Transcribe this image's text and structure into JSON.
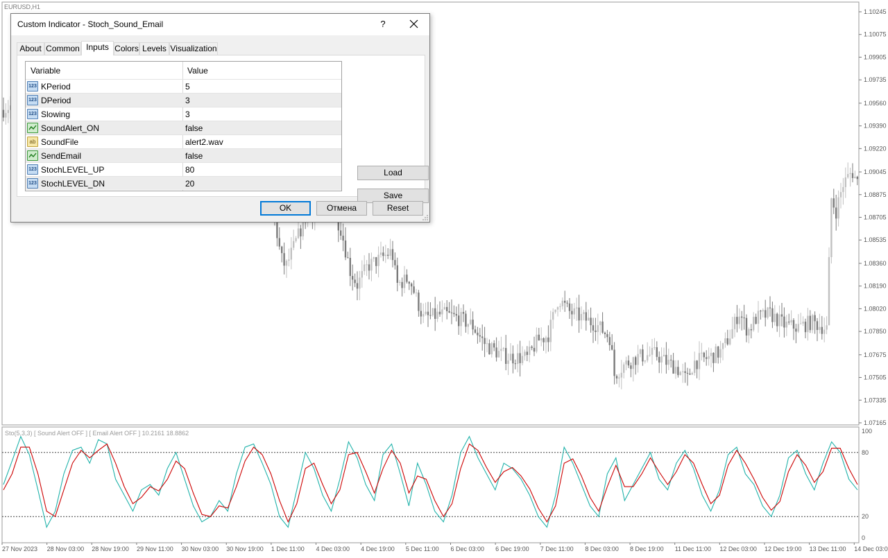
{
  "chart": {
    "symbol_label": "EURUSD,H1",
    "price_ticks": [
      "1.10245",
      "1.10075",
      "1.09905",
      "1.09735",
      "1.09560",
      "1.09390",
      "1.09220",
      "1.09045",
      "1.08875",
      "1.08705",
      "1.08535",
      "1.08360",
      "1.08190",
      "1.08020",
      "1.07850",
      "1.07675",
      "1.07505",
      "1.07335",
      "1.07165"
    ],
    "time_ticks": [
      "27 Nov 2023",
      "28 Nov 03:00",
      "28 Nov 19:00",
      "29 Nov 11:00",
      "30 Nov 03:00",
      "30 Nov 19:00",
      "1 Dec 11:00",
      "4 Dec 03:00",
      "4 Dec 19:00",
      "5 Dec 11:00",
      "6 Dec 03:00",
      "6 Dec 19:00",
      "7 Dec 11:00",
      "8 Dec 03:00",
      "8 Dec 19:00",
      "11 Dec 11:00",
      "12 Dec 03:00",
      "12 Dec 19:00",
      "13 Dec 11:00",
      "14 Dec 03:00"
    ],
    "indicator_label": "Sto(5,3,3) [ Sound Alert OFF ] [ Email Alert OFF ] 10.2161 18.8862",
    "stoch_ticks": [
      "100",
      "80",
      "20",
      "0"
    ],
    "colors": {
      "main_line": "#20b2aa",
      "signal_line": "#cc0000",
      "candle_up": "#c0c0c0",
      "candle_down": "#7a7a7a",
      "level_line": "#404040"
    }
  },
  "chart_data": [
    {
      "type": "candlestick",
      "title": "EURUSD,H1",
      "ylim": [
        1.07165,
        1.10245
      ],
      "close_path": [
        [
          0,
          1.095
        ],
        [
          20,
          1.0955
        ],
        [
          60,
          1.0942
        ],
        [
          120,
          1.0935
        ],
        [
          200,
          1.0915
        ],
        [
          280,
          1.0905
        ],
        [
          340,
          1.0895
        ],
        [
          390,
          1.0888
        ],
        [
          405,
          1.084
        ],
        [
          412,
          1.0833
        ],
        [
          440,
          1.087
        ],
        [
          470,
          1.088
        ],
        [
          490,
          1.0865
        ],
        [
          505,
          1.083
        ],
        [
          515,
          1.082
        ],
        [
          530,
          1.0834
        ],
        [
          550,
          1.084
        ],
        [
          565,
          1.0845
        ],
        [
          572,
          1.082
        ],
        [
          590,
          1.0825
        ],
        [
          600,
          1.081
        ],
        [
          610,
          1.0795
        ],
        [
          640,
          1.0798
        ],
        [
          660,
          1.0795
        ],
        [
          680,
          1.079
        ],
        [
          700,
          1.0775
        ],
        [
          715,
          1.077
        ],
        [
          730,
          1.0766
        ],
        [
          760,
          1.0765
        ],
        [
          775,
          1.0778
        ],
        [
          790,
          1.0782
        ],
        [
          805,
          1.081
        ],
        [
          820,
          1.08
        ],
        [
          840,
          1.0795
        ],
        [
          860,
          1.079
        ],
        [
          880,
          1.078
        ],
        [
          885,
          1.0752
        ],
        [
          900,
          1.076
        ],
        [
          920,
          1.0766
        ],
        [
          945,
          1.0768
        ],
        [
          960,
          1.0762
        ],
        [
          975,
          1.0758
        ],
        [
          990,
          1.0748
        ],
        [
          1000,
          1.0762
        ],
        [
          1020,
          1.0765
        ],
        [
          1040,
          1.077
        ],
        [
          1055,
          1.0785
        ],
        [
          1065,
          1.08
        ],
        [
          1078,
          1.0785
        ],
        [
          1090,
          1.0795
        ],
        [
          1110,
          1.0798
        ],
        [
          1130,
          1.079
        ],
        [
          1150,
          1.0788
        ],
        [
          1170,
          1.0792
        ],
        [
          1192,
          1.0787
        ],
        [
          1198,
          1.0885
        ],
        [
          1205,
          1.0875
        ],
        [
          1215,
          1.0895
        ],
        [
          1228,
          1.0905
        ],
        [
          1238,
          1.0895
        ]
      ]
    },
    {
      "type": "line",
      "title": "Sto(5,3,3) [ Sound Alert OFF ] [ Email Alert OFF ] 10.2161 18.8862",
      "ylim": [
        0,
        100
      ],
      "levels": [
        80,
        20
      ],
      "series": [
        {
          "values": [
            50,
            72,
            95,
            78,
            45,
            10,
            25,
            60,
            82,
            85,
            70,
            92,
            88,
            55,
            40,
            25,
            45,
            50,
            40,
            65,
            80,
            55,
            30,
            15,
            20,
            35,
            25,
            60,
            85,
            88,
            70,
            50,
            20,
            10,
            45,
            80,
            65,
            40,
            25,
            55,
            90,
            75,
            50,
            35,
            78,
            88,
            60,
            30,
            70,
            50,
            25,
            15,
            40,
            80,
            95,
            75,
            60,
            45,
            70,
            65,
            55,
            40,
            20,
            10,
            40,
            85,
            70,
            50,
            30,
            20,
            60,
            75,
            35,
            50,
            65,
            80,
            55,
            45,
            70,
            82,
            65,
            40,
            25,
            45,
            78,
            85,
            60,
            50,
            30,
            20,
            40,
            75,
            82,
            60,
            45,
            70,
            90,
            80,
            55,
            45
          ]
        },
        {
          "values": [
            45,
            60,
            85,
            85,
            60,
            25,
            20,
            45,
            70,
            82,
            75,
            82,
            88,
            70,
            48,
            32,
            38,
            48,
            44,
            55,
            72,
            65,
            42,
            22,
            20,
            30,
            28,
            48,
            72,
            85,
            78,
            60,
            35,
            15,
            32,
            65,
            70,
            50,
            32,
            45,
            78,
            80,
            62,
            42,
            65,
            82,
            70,
            42,
            58,
            55,
            35,
            20,
            32,
            65,
            88,
            82,
            66,
            52,
            62,
            66,
            58,
            46,
            28,
            15,
            30,
            70,
            74,
            58,
            38,
            25,
            48,
            68,
            48,
            48,
            60,
            75,
            62,
            50,
            62,
            78,
            70,
            50,
            32,
            40,
            68,
            82,
            70,
            55,
            38,
            26,
            34,
            62,
            78,
            68,
            52,
            62,
            84,
            84,
            65,
            50
          ]
        }
      ]
    }
  ],
  "dialog": {
    "title": "Custom Indicator - Stoch_Sound_Email",
    "help": "?",
    "tabs": [
      "About",
      "Common",
      "Inputs",
      "Colors",
      "Levels",
      "Visualization"
    ],
    "active_tab": "Inputs",
    "grid": {
      "col_variable": "Variable",
      "col_value": "Value",
      "rows": [
        {
          "icon": "number-icon",
          "icon_text": "123",
          "name": "KPeriod",
          "value": "5"
        },
        {
          "icon": "number-icon",
          "icon_text": "123",
          "name": "DPeriod",
          "value": "3"
        },
        {
          "icon": "number-icon",
          "icon_text": "123",
          "name": "Slowing",
          "value": "3"
        },
        {
          "icon": "boolean-icon",
          "icon_text": "",
          "name": "SoundAlert_ON",
          "value": "false"
        },
        {
          "icon": "string-icon",
          "icon_text": "ab",
          "name": "SoundFile",
          "value": "alert2.wav"
        },
        {
          "icon": "boolean-icon",
          "icon_text": "",
          "name": "SendEmail",
          "value": "false"
        },
        {
          "icon": "number-icon",
          "icon_text": "123",
          "name": "StochLEVEL_UP",
          "value": "80"
        },
        {
          "icon": "number-icon",
          "icon_text": "123",
          "name": "StochLEVEL_DN",
          "value": "20"
        }
      ]
    },
    "buttons": {
      "load": "Load",
      "save": "Save",
      "ok": "OK",
      "cancel": "Отмена",
      "reset": "Reset"
    }
  }
}
